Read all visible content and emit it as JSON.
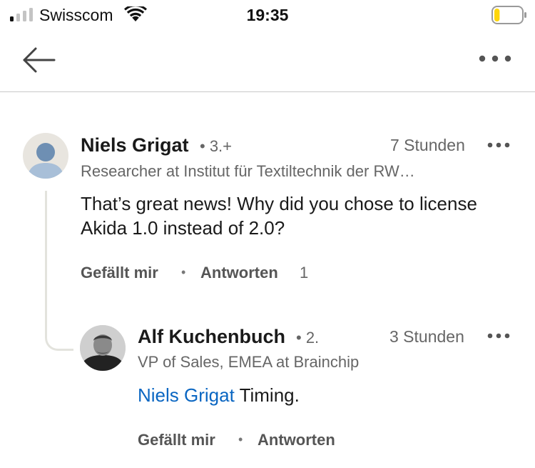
{
  "status_bar": {
    "carrier": "Swisscom",
    "time": "19:35",
    "signal_bars_active": 1,
    "battery_level": 0.2,
    "battery_color": "#ffd60a"
  },
  "nav": {
    "back_icon": "arrow-left-icon",
    "more_icon": "more-horizontal-icon"
  },
  "comments": [
    {
      "author": "Niels Grigat",
      "degree": "• 3.+",
      "time": "7 Stunden",
      "headline": "Researcher at Institut für Textiltechnik der RW…",
      "text": "That’s great news! Why did you chose to license Akida 1.0 instead of 2.0?",
      "like_label": "Gefällt mir",
      "reply_label": "Antworten",
      "reply_count": "1"
    }
  ],
  "replies": [
    {
      "author": "Alf Kuchenbuch",
      "degree": "• 2.",
      "time": "3 Stunden",
      "headline": "VP of Sales, EMEA at Brainchip",
      "mention": "Niels Grigat",
      "text": " Timing.",
      "like_label": "Gefällt mir",
      "reply_label": "Antworten"
    }
  ],
  "colors": {
    "link": "#0a66c2",
    "thread_line": "#e3e3dd"
  }
}
